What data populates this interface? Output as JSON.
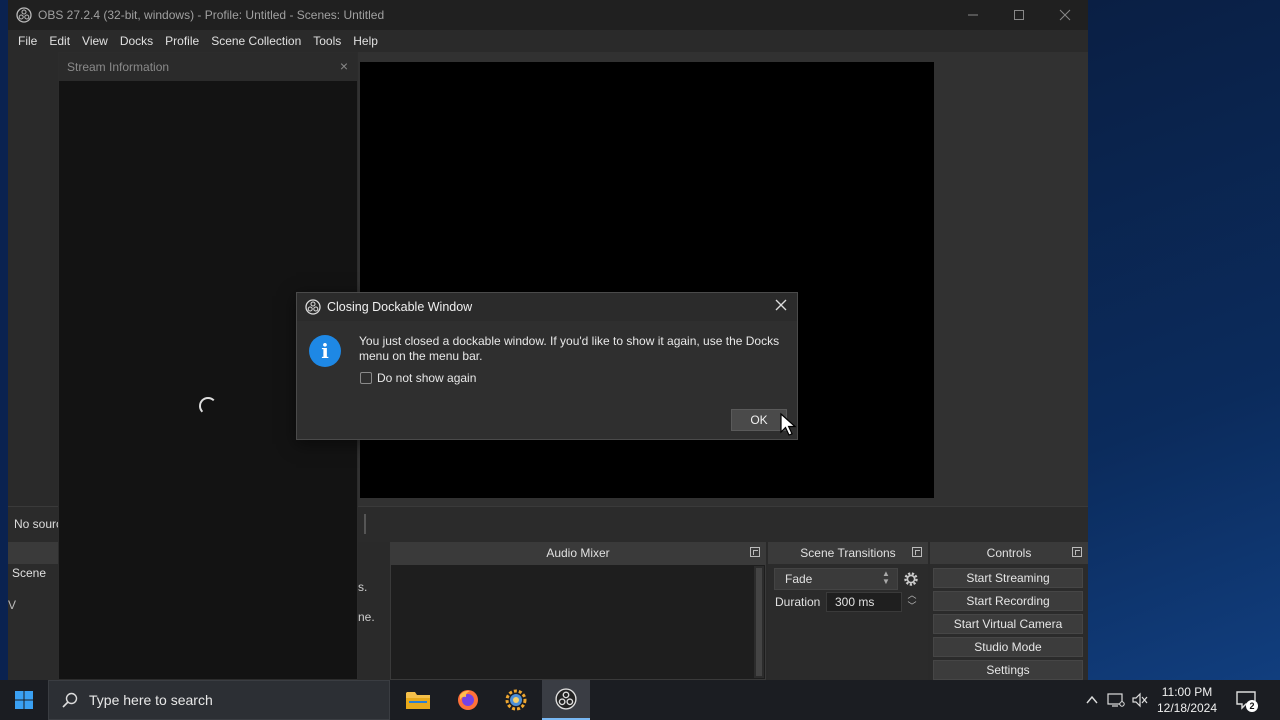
{
  "window": {
    "title": "OBS 27.2.4 (32-bit, windows) - Profile: Untitled - Scenes: Untitled"
  },
  "menu": [
    "File",
    "Edit",
    "View",
    "Docks",
    "Profile",
    "Scene Collection",
    "Tools",
    "Help"
  ],
  "stream_info": {
    "title": "Stream Information",
    "close": "×"
  },
  "sources": {
    "no_source_text": "No sourc"
  },
  "scenes": {
    "header": "Scene",
    "frag1": "s.",
    "frag2": "ne.",
    "left_char": "V"
  },
  "audio_mixer": {
    "header": "Audio Mixer"
  },
  "scene_transitions": {
    "header": "Scene Transitions",
    "transition": "Fade",
    "duration_label": "Duration",
    "duration_value": "300 ms"
  },
  "controls": {
    "header": "Controls",
    "buttons": [
      "Start Streaming",
      "Start Recording",
      "Start Virtual Camera",
      "Studio Mode",
      "Settings"
    ]
  },
  "dialog": {
    "title": "Closing Dockable Window",
    "message": "You just closed a dockable window. If you'd like to show it again, use the Docks menu on the menu bar.",
    "checkbox_label": "Do not show again",
    "ok_label": "OK"
  },
  "taskbar": {
    "search_placeholder": "Type here to search",
    "time": "11:00 PM",
    "date": "12/18/2024",
    "notification_count": "2"
  },
  "colors": {
    "info_blue": "#1e88e5",
    "taskbar_bg": "#1b1d22",
    "active_underline": "#79b8f3"
  }
}
